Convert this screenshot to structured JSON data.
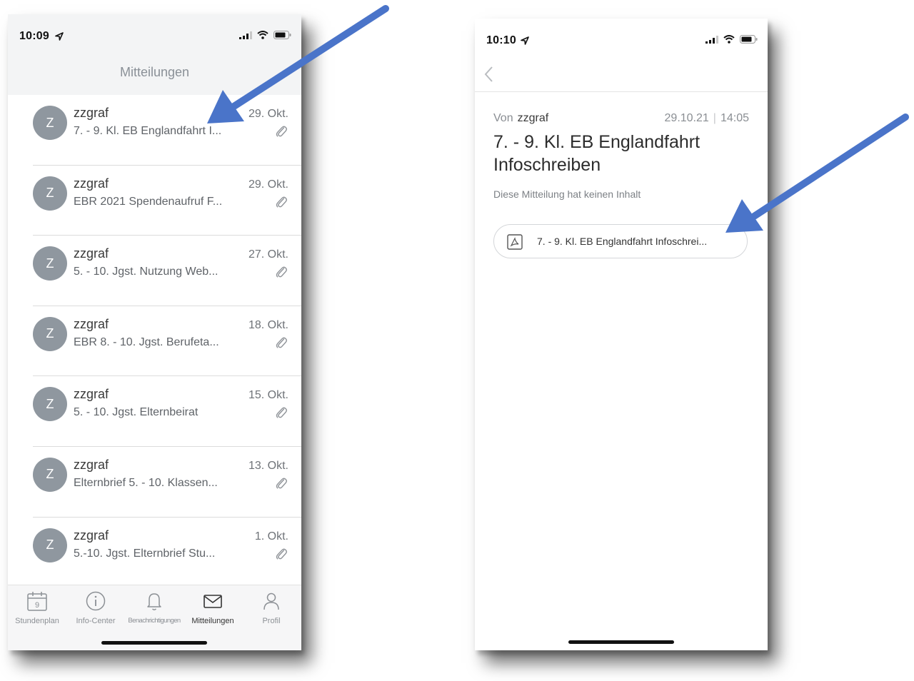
{
  "left_screen": {
    "status_time": "10:09",
    "title": "Mitteilungen",
    "messages": [
      {
        "avatar": "Z",
        "sender": "zzgraf",
        "subject": "7. - 9. Kl. EB Englandfahrt I...",
        "date": "29. Okt."
      },
      {
        "avatar": "Z",
        "sender": "zzgraf",
        "subject": "EBR 2021 Spendenaufruf F...",
        "date": "29. Okt."
      },
      {
        "avatar": "Z",
        "sender": "zzgraf",
        "subject": "5. - 10. Jgst. Nutzung Web...",
        "date": "27. Okt."
      },
      {
        "avatar": "Z",
        "sender": "zzgraf",
        "subject": "EBR 8. - 10. Jgst. Berufeta...",
        "date": "18. Okt."
      },
      {
        "avatar": "Z",
        "sender": "zzgraf",
        "subject": "5. - 10. Jgst. Elternbeirat",
        "date": "15. Okt."
      },
      {
        "avatar": "Z",
        "sender": "zzgraf",
        "subject": "Elternbrief 5. - 10. Klassen...",
        "date": "13. Okt."
      },
      {
        "avatar": "Z",
        "sender": "zzgraf",
        "subject": "5.-10. Jgst. Elternbrief  Stu...",
        "date": "1. Okt."
      }
    ],
    "tabs": [
      {
        "label": "Stundenplan",
        "icon": "calendar-icon",
        "badge": "9"
      },
      {
        "label": "Info-Center",
        "icon": "info-icon"
      },
      {
        "label": "Benachrichtigungen",
        "icon": "bell-icon"
      },
      {
        "label": "Mitteilungen",
        "icon": "envelope-icon"
      },
      {
        "label": "Profil",
        "icon": "person-icon"
      }
    ]
  },
  "right_screen": {
    "status_time": "10:10",
    "from_label": "Von",
    "from_name": "zzgraf",
    "date": "29.10.21",
    "separator": "|",
    "time": "14:05",
    "title": "7. - 9. Kl. EB Englandfahrt Infoschreiben",
    "no_content": "Diese Mitteilung hat keinen Inhalt",
    "attachment_name": "7. - 9. Kl. EB Englandfahrt Infoschrei..."
  },
  "colors": {
    "avatar": "#8f979f",
    "arrow": "#4a74c9",
    "header_bg": "#f3f4f5"
  }
}
